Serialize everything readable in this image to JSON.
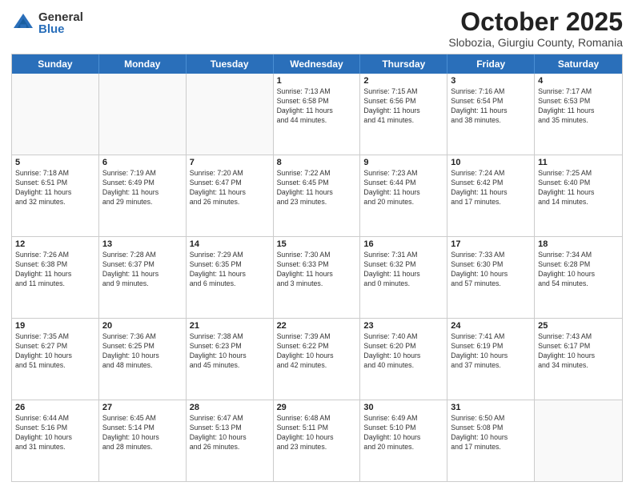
{
  "header": {
    "logo": {
      "general": "General",
      "blue": "Blue"
    },
    "title": "October 2025",
    "subtitle": "Slobozia, Giurgiu County, Romania"
  },
  "days_of_week": [
    "Sunday",
    "Monday",
    "Tuesday",
    "Wednesday",
    "Thursday",
    "Friday",
    "Saturday"
  ],
  "weeks": [
    [
      {
        "day": "",
        "content": ""
      },
      {
        "day": "",
        "content": ""
      },
      {
        "day": "",
        "content": ""
      },
      {
        "day": "1",
        "content": "Sunrise: 7:13 AM\nSunset: 6:58 PM\nDaylight: 11 hours\nand 44 minutes."
      },
      {
        "day": "2",
        "content": "Sunrise: 7:15 AM\nSunset: 6:56 PM\nDaylight: 11 hours\nand 41 minutes."
      },
      {
        "day": "3",
        "content": "Sunrise: 7:16 AM\nSunset: 6:54 PM\nDaylight: 11 hours\nand 38 minutes."
      },
      {
        "day": "4",
        "content": "Sunrise: 7:17 AM\nSunset: 6:53 PM\nDaylight: 11 hours\nand 35 minutes."
      }
    ],
    [
      {
        "day": "5",
        "content": "Sunrise: 7:18 AM\nSunset: 6:51 PM\nDaylight: 11 hours\nand 32 minutes."
      },
      {
        "day": "6",
        "content": "Sunrise: 7:19 AM\nSunset: 6:49 PM\nDaylight: 11 hours\nand 29 minutes."
      },
      {
        "day": "7",
        "content": "Sunrise: 7:20 AM\nSunset: 6:47 PM\nDaylight: 11 hours\nand 26 minutes."
      },
      {
        "day": "8",
        "content": "Sunrise: 7:22 AM\nSunset: 6:45 PM\nDaylight: 11 hours\nand 23 minutes."
      },
      {
        "day": "9",
        "content": "Sunrise: 7:23 AM\nSunset: 6:44 PM\nDaylight: 11 hours\nand 20 minutes."
      },
      {
        "day": "10",
        "content": "Sunrise: 7:24 AM\nSunset: 6:42 PM\nDaylight: 11 hours\nand 17 minutes."
      },
      {
        "day": "11",
        "content": "Sunrise: 7:25 AM\nSunset: 6:40 PM\nDaylight: 11 hours\nand 14 minutes."
      }
    ],
    [
      {
        "day": "12",
        "content": "Sunrise: 7:26 AM\nSunset: 6:38 PM\nDaylight: 11 hours\nand 11 minutes."
      },
      {
        "day": "13",
        "content": "Sunrise: 7:28 AM\nSunset: 6:37 PM\nDaylight: 11 hours\nand 9 minutes."
      },
      {
        "day": "14",
        "content": "Sunrise: 7:29 AM\nSunset: 6:35 PM\nDaylight: 11 hours\nand 6 minutes."
      },
      {
        "day": "15",
        "content": "Sunrise: 7:30 AM\nSunset: 6:33 PM\nDaylight: 11 hours\nand 3 minutes."
      },
      {
        "day": "16",
        "content": "Sunrise: 7:31 AM\nSunset: 6:32 PM\nDaylight: 11 hours\nand 0 minutes."
      },
      {
        "day": "17",
        "content": "Sunrise: 7:33 AM\nSunset: 6:30 PM\nDaylight: 10 hours\nand 57 minutes."
      },
      {
        "day": "18",
        "content": "Sunrise: 7:34 AM\nSunset: 6:28 PM\nDaylight: 10 hours\nand 54 minutes."
      }
    ],
    [
      {
        "day": "19",
        "content": "Sunrise: 7:35 AM\nSunset: 6:27 PM\nDaylight: 10 hours\nand 51 minutes."
      },
      {
        "day": "20",
        "content": "Sunrise: 7:36 AM\nSunset: 6:25 PM\nDaylight: 10 hours\nand 48 minutes."
      },
      {
        "day": "21",
        "content": "Sunrise: 7:38 AM\nSunset: 6:23 PM\nDaylight: 10 hours\nand 45 minutes."
      },
      {
        "day": "22",
        "content": "Sunrise: 7:39 AM\nSunset: 6:22 PM\nDaylight: 10 hours\nand 42 minutes."
      },
      {
        "day": "23",
        "content": "Sunrise: 7:40 AM\nSunset: 6:20 PM\nDaylight: 10 hours\nand 40 minutes."
      },
      {
        "day": "24",
        "content": "Sunrise: 7:41 AM\nSunset: 6:19 PM\nDaylight: 10 hours\nand 37 minutes."
      },
      {
        "day": "25",
        "content": "Sunrise: 7:43 AM\nSunset: 6:17 PM\nDaylight: 10 hours\nand 34 minutes."
      }
    ],
    [
      {
        "day": "26",
        "content": "Sunrise: 6:44 AM\nSunset: 5:16 PM\nDaylight: 10 hours\nand 31 minutes."
      },
      {
        "day": "27",
        "content": "Sunrise: 6:45 AM\nSunset: 5:14 PM\nDaylight: 10 hours\nand 28 minutes."
      },
      {
        "day": "28",
        "content": "Sunrise: 6:47 AM\nSunset: 5:13 PM\nDaylight: 10 hours\nand 26 minutes."
      },
      {
        "day": "29",
        "content": "Sunrise: 6:48 AM\nSunset: 5:11 PM\nDaylight: 10 hours\nand 23 minutes."
      },
      {
        "day": "30",
        "content": "Sunrise: 6:49 AM\nSunset: 5:10 PM\nDaylight: 10 hours\nand 20 minutes."
      },
      {
        "day": "31",
        "content": "Sunrise: 6:50 AM\nSunset: 5:08 PM\nDaylight: 10 hours\nand 17 minutes."
      },
      {
        "day": "",
        "content": ""
      }
    ]
  ]
}
